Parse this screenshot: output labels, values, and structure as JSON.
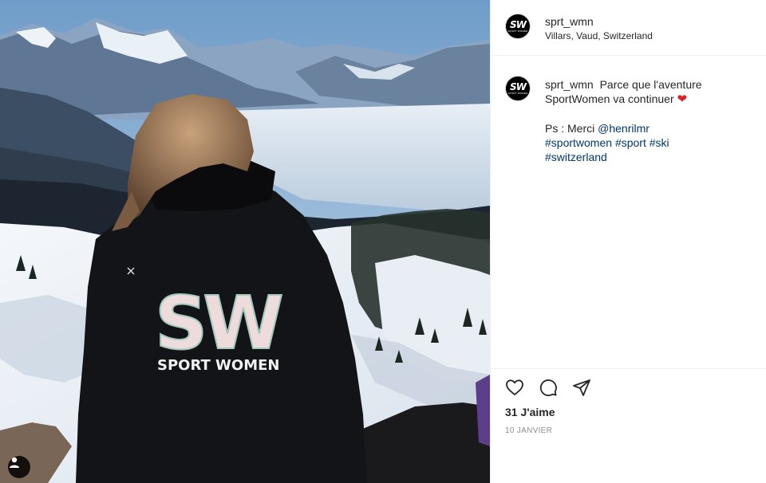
{
  "post": {
    "username": "sprt_wmn",
    "location": "Villars, Vaud, Switzerland",
    "avatar_monogram": "SW",
    "avatar_subtext": "SPORT WOMEN"
  },
  "photo": {
    "jacket_monogram": "SW",
    "jacket_text": "SPORT WOMEN"
  },
  "caption": {
    "username": "sprt_wmn",
    "text": "Parce que l'aventure SportWomen va continuer",
    "heart": "❤",
    "ps_prefix": "Ps : Merci",
    "mention": "@henrilmr",
    "hashtags": [
      "#sportwomen",
      "#sport",
      "#ski",
      "#switzerland"
    ]
  },
  "actions": {
    "like_icon": "heart-outline-icon",
    "comment_icon": "speech-bubble-icon",
    "share_icon": "paper-plane-icon"
  },
  "likes_text": "31 J'aime",
  "date_text": "10 JANVIER",
  "colors": {
    "link": "#00376b",
    "heart": "#d8232a",
    "muted": "#8e8e8e",
    "divider": "#efefef"
  }
}
